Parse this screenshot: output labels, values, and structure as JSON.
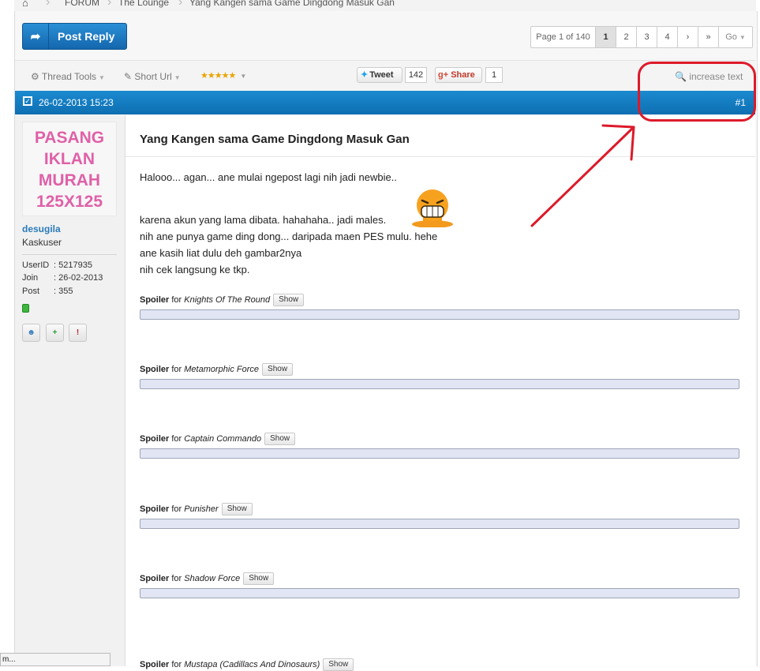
{
  "breadcrumb": {
    "items": [
      "FORUM",
      "The Lounge",
      "Yang Kangen sama Game Dingdong Masuk Gan"
    ]
  },
  "toolbar": {
    "post_reply": "Post Reply"
  },
  "pagination": {
    "info": "Page 1 of 140",
    "pages": [
      "1",
      "2",
      "3",
      "4"
    ],
    "go": "Go"
  },
  "tools": {
    "thread_tools": "Thread Tools",
    "short_url": "Short Url",
    "rating": "★★★★★",
    "tweet": "Tweet",
    "tweet_count": "142",
    "share": "Share",
    "share_count": "1",
    "increase_text": "increase text"
  },
  "post": {
    "date": "26-02-2013 15:23",
    "number": "#1",
    "title": "Yang Kangen sama Game Dingdong Masuk Gan",
    "lines": [
      "Halooo... agan... ane mulai ngepost lagi nih jadi newbie..",
      "karena akun yang lama dibata. hahahaha.. jadi males.",
      "nih ane punya game ding dong... daripada maen PES mulu. hehe",
      "ane kasih liat dulu deh gambar2nya",
      "nih cek langsung ke tkp."
    ],
    "spoilers": [
      {
        "label": "Spoiler",
        "for": "for",
        "title": "Knights Of The Round",
        "show": "Show"
      },
      {
        "label": "Spoiler",
        "for": "for",
        "title": "Metamorphic Force",
        "show": "Show"
      },
      {
        "label": "Spoiler",
        "for": "for",
        "title": "Captain Commando",
        "show": "Show"
      },
      {
        "label": "Spoiler",
        "for": "for",
        "title": "Punisher",
        "show": "Show"
      },
      {
        "label": "Spoiler",
        "for": "for",
        "title": "Shadow Force",
        "show": "Show"
      },
      {
        "label": "Spoiler",
        "for": "for",
        "title": "Mustapa (Cadillacs And Dinosaurs)",
        "show": "Show"
      }
    ]
  },
  "user": {
    "ad_lines": [
      "PASANG",
      "IKLAN",
      "MURAH",
      "125X125"
    ],
    "name": "desugila",
    "rank": "Kaskuser",
    "stats": [
      {
        "key": "UserID",
        "value": ": 5217935"
      },
      {
        "key": "Join",
        "value": ": 26-02-2013"
      },
      {
        "key": "Post",
        "value": ": 355"
      }
    ]
  },
  "status_bar": "m...",
  "colors": {
    "header_blue": "#1b8ad0",
    "annotation_red": "#dd1a2a",
    "ad_pink": "#e060a8",
    "username_blue": "#2b7bb9"
  }
}
